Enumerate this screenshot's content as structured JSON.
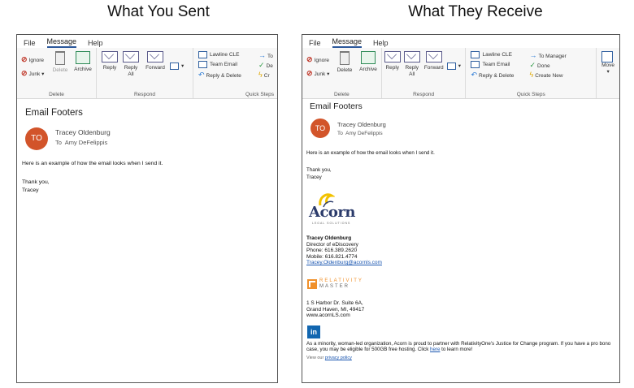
{
  "captions": {
    "left": "What You Sent",
    "right": "What They Receive"
  },
  "menu": {
    "file": "File",
    "message": "Message",
    "help": "Help"
  },
  "ribbon": {
    "ignore": "Ignore",
    "junk": "Junk",
    "delete": "Delete",
    "archive": "Archive",
    "group_delete": "Delete",
    "reply": "Reply",
    "reply_all": "Reply All",
    "forward": "Forward",
    "group_respond": "Respond",
    "group_quick_steps": "Quick Steps",
    "move": "Move",
    "quick_steps": [
      "Lawline CLE",
      "Team Email",
      "Reply & Delete"
    ],
    "quick_steps_right": [
      "To Manager",
      "Done",
      "Create New"
    ],
    "quick_steps_left_cut": [
      "To",
      "De",
      "Cr"
    ]
  },
  "message": {
    "subject": "Email Footers",
    "avatar_initials": "TO",
    "sender": "Tracey Oldenburg",
    "to_label": "To",
    "recipient": "Amy DeFelippis",
    "body_line": "Here is an example of how the email looks when I send it.",
    "closing": "Thank you,",
    "name": "Tracey"
  },
  "signature": {
    "logo_word": "Acorn",
    "logo_sub": "LEGAL SOLUTIONS",
    "name": "Tracey Oldenburg",
    "title": "Director of eDiscovery",
    "phone": "Phone: 616.389.2620",
    "mobile": "Mobile: 616.821.4774",
    "email": "Tracey.Oldenburg@acornls.com",
    "relativity_top": "RELATIVITY",
    "relativity_bottom": "MASTER",
    "address1": "1 S Harbor Dr. Suite 6A,",
    "address2": "Grand Haven, MI, 49417",
    "website": "www.acornLS.com",
    "linkedin": "in",
    "disclaimer_pre": "As a minority, woman-led organization, Acorn is proud to partner with RelativityOne's Justice for Change program. If you have a pro bono case, you may be eligible for 500GB free hosting. Click",
    "disclaimer_link": "here",
    "disclaimer_post": "to learn more!",
    "privacy_pre": "View our",
    "privacy_link": "privacy policy"
  },
  "colors": {
    "avatar": "#d2542a",
    "accent": "#2b579a",
    "linkedin": "#1266b0",
    "relativity": "#f0902a"
  }
}
